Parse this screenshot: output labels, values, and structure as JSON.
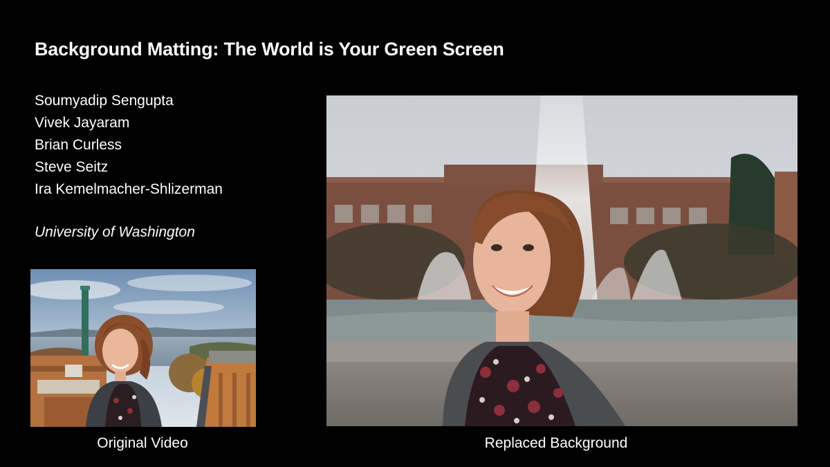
{
  "title": "Background Matting: The World is Your Green Screen",
  "authors": [
    "Soumyadip Sengupta",
    "Vivek Jayaram",
    "Brian Curless",
    "Steve Seitz",
    "Ira Kemelmacher-Shlizerman"
  ],
  "affiliation": "University of Washington",
  "panels": {
    "original": {
      "caption": "Original Video"
    },
    "replaced": {
      "caption": "Replaced Background"
    }
  },
  "colors": {
    "background": "#000000",
    "text": "#ffffff"
  }
}
